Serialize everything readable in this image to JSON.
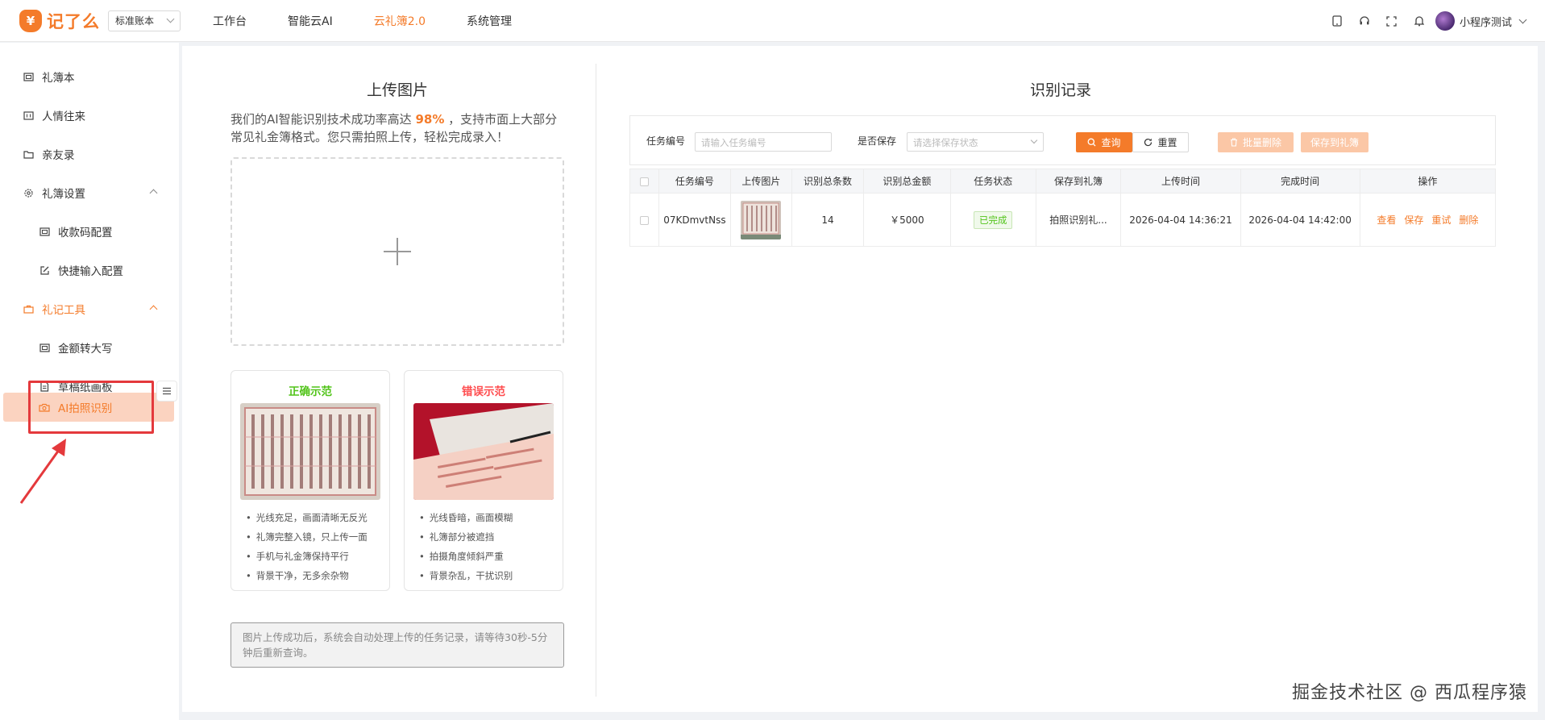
{
  "header": {
    "logo_badge": "¥",
    "logo_text": "记了么",
    "account_select": "标准账本",
    "nav": [
      "工作台",
      "智能云AI",
      "云礼簿2.0",
      "系统管理"
    ],
    "active_nav_index": 2,
    "username": "小程序测试",
    "icons": [
      "tablet-icon",
      "headset-icon",
      "fullscreen-icon",
      "bell-icon"
    ]
  },
  "sidebar": {
    "items": [
      {
        "label": "礼簿本",
        "icon": "book-icon"
      },
      {
        "label": "人情往来",
        "icon": "ledger-icon"
      },
      {
        "label": "亲友录",
        "icon": "folder-icon"
      },
      {
        "label": "礼簿设置",
        "icon": "gear-icon"
      },
      {
        "label": "收款码配置",
        "icon": "qrcode-icon"
      },
      {
        "label": "快捷输入配置",
        "icon": "edit-icon"
      },
      {
        "label": "礼记工具",
        "icon": "toolbox-icon"
      },
      {
        "label": "金额转大写",
        "icon": "convert-icon"
      },
      {
        "label": "草稿纸画板",
        "icon": "document-icon"
      },
      {
        "label": "AI拍照识别",
        "icon": "camera-icon"
      }
    ]
  },
  "upload": {
    "title": "上传图片",
    "desc_before": "我们的AI智能识别技术成功率高达",
    "rate": "98%",
    "desc_after": "，支持市面上大部分常见礼金簿格式。您只需拍照上传，轻松完成录入！",
    "good_title": "正确示范",
    "good_tips": [
      "光线充足，画面清晰无反光",
      "礼簿完整入镜，只上传一面",
      "手机与礼金簿保持平行",
      "背景干净，无多余杂物"
    ],
    "bad_title": "错误示范",
    "bad_tips": [
      "光线昏暗，画面模糊",
      "礼簿部分被遮挡",
      "拍摄角度倾斜严重",
      "背景杂乱，干扰识别"
    ],
    "notice": "图片上传成功后，系统会自动处理上传的任务记录，请等待30秒-5分钟后重新查询。"
  },
  "records": {
    "title": "识别记录",
    "filter": {
      "task_label": "任务编号",
      "task_placeholder": "请输入任务编号",
      "save_label": "是否保存",
      "save_placeholder": "请选择保存状态",
      "query": "查询",
      "reset": "重置",
      "batch_delete": "批量删除",
      "save_to_book": "保存到礼簿"
    },
    "columns": [
      "任务编号",
      "上传图片",
      "识别总条数",
      "识别总金额",
      "任务状态",
      "保存到礼簿",
      "上传时间",
      "完成时间",
      "操作"
    ],
    "rows": [
      {
        "task_id": "07KDmvtNss",
        "total_count": "14",
        "total_amount": "￥5000",
        "status": "已完成",
        "saved_to": "拍照识别礼...",
        "upload_time": "2026-04-04 14:36:21",
        "finish_time": "2026-04-04 14:42:00",
        "actions": [
          "查看",
          "保存",
          "重试",
          "删除"
        ]
      }
    ]
  },
  "watermark": "掘金技术社区 @ 西瓜程序猿",
  "colors": {
    "accent": "#f47b2a",
    "success": "#52c41a",
    "danger": "#ff4d4f",
    "highlight_box": "#e4393c"
  }
}
